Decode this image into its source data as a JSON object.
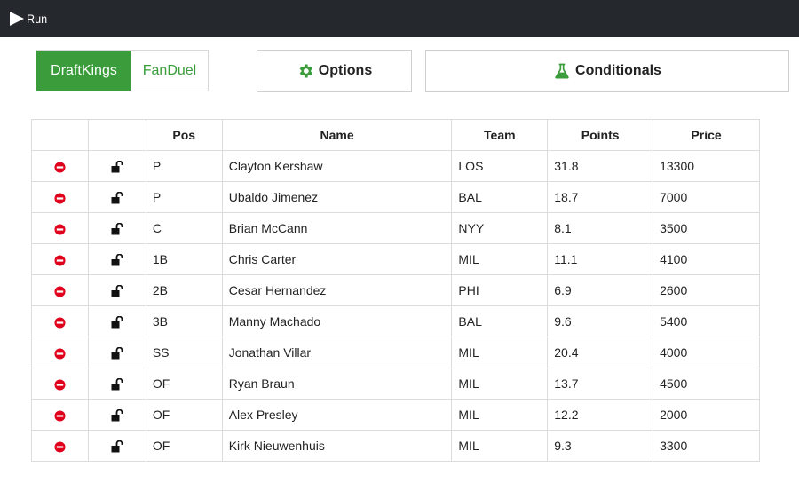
{
  "topbar": {
    "run_label": "Run",
    "run_icon": "play-icon"
  },
  "site_toggle": {
    "selected": "DraftKings",
    "options": [
      "DraftKings",
      "FanDuel"
    ]
  },
  "buttons": {
    "options_label": "Options",
    "options_icon": "gear-icon",
    "conditionals_label": "Conditionals",
    "conditionals_icon": "flask-icon"
  },
  "colors": {
    "accent": "#3a9c3a",
    "topbar": "#25292e",
    "remove": "#e0001b"
  },
  "table": {
    "headers": [
      "",
      "",
      "Pos",
      "Name",
      "Team",
      "Points",
      "Price"
    ],
    "rows": [
      {
        "pos": "P",
        "name": "Clayton Kershaw",
        "team": "LOS",
        "points": "31.8",
        "price": "13300"
      },
      {
        "pos": "P",
        "name": "Ubaldo Jimenez",
        "team": "BAL",
        "points": "18.7",
        "price": "7000"
      },
      {
        "pos": "C",
        "name": "Brian McCann",
        "team": "NYY",
        "points": "8.1",
        "price": "3500"
      },
      {
        "pos": "1B",
        "name": "Chris Carter",
        "team": "MIL",
        "points": "11.1",
        "price": "4100"
      },
      {
        "pos": "2B",
        "name": "Cesar Hernandez",
        "team": "PHI",
        "points": "6.9",
        "price": "2600"
      },
      {
        "pos": "3B",
        "name": "Manny Machado",
        "team": "BAL",
        "points": "9.6",
        "price": "5400"
      },
      {
        "pos": "SS",
        "name": "Jonathan Villar",
        "team": "MIL",
        "points": "20.4",
        "price": "4000"
      },
      {
        "pos": "OF",
        "name": "Ryan Braun",
        "team": "MIL",
        "points": "13.7",
        "price": "4500"
      },
      {
        "pos": "OF",
        "name": "Alex Presley",
        "team": "MIL",
        "points": "12.2",
        "price": "2000"
      },
      {
        "pos": "OF",
        "name": "Kirk Nieuwenhuis",
        "team": "MIL",
        "points": "9.3",
        "price": "3300"
      }
    ],
    "row_icons": [
      "remove-icon",
      "unlock-icon"
    ]
  }
}
